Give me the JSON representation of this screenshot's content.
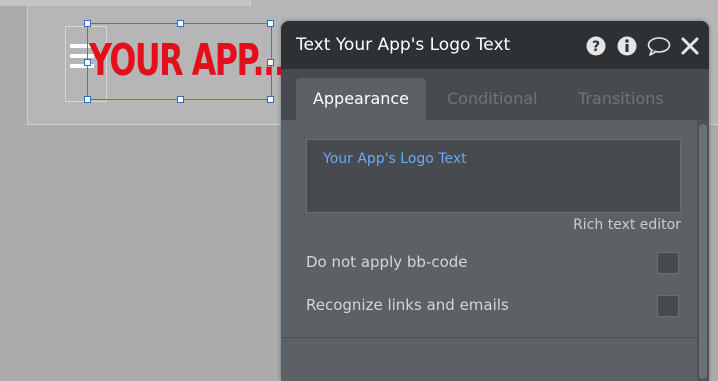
{
  "canvas": {
    "logo_text": "YOUR APP...",
    "logo_color": "#e3101b",
    "selection_color": "#3a7bd5"
  },
  "panel": {
    "title": "Text Your App's Logo Text",
    "header_icons": [
      "help-icon",
      "info-icon",
      "comment-icon",
      "close-icon"
    ],
    "tabs": [
      {
        "label": "Appearance",
        "active": true
      },
      {
        "label": "Conditional",
        "active": false
      },
      {
        "label": "Transitions",
        "active": false
      }
    ],
    "text_value": "Your App's Logo Text",
    "rich_text_label": "Rich text editor",
    "options": [
      {
        "label": "Do not apply bb-code",
        "checked": false
      },
      {
        "label": "Recognize links and emails",
        "checked": false
      }
    ]
  }
}
